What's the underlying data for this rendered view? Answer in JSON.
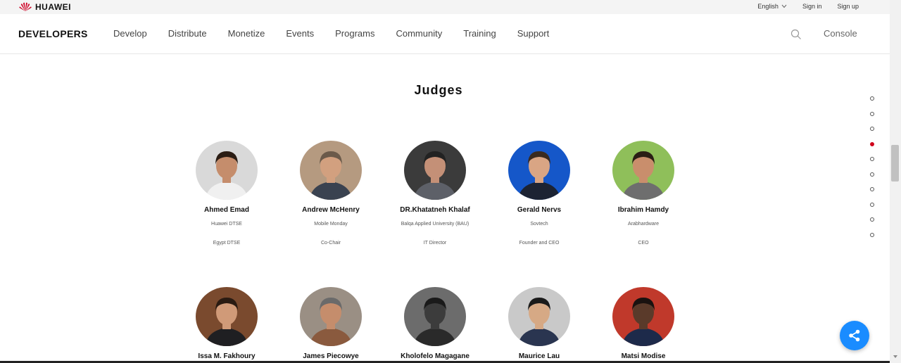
{
  "topbar": {
    "brand": "HUAWEI",
    "language": "English",
    "sign_in": "Sign in",
    "sign_up": "Sign up"
  },
  "navbar": {
    "logo": "DEVELOPERS",
    "items": [
      "Develop",
      "Distribute",
      "Monetize",
      "Events",
      "Programs",
      "Community",
      "Training",
      "Support"
    ],
    "console": "Console"
  },
  "section": {
    "title": "Judges"
  },
  "judges_row1": [
    {
      "name": "Ahmed Emad",
      "org": "Huawei DTSE",
      "role": "Egypt DTSE",
      "bg": "#d9d9d9",
      "skin": "#c58d6c",
      "hair": "#2b1d14",
      "suit": "#f0f0f0"
    },
    {
      "name": "Andrew McHenry",
      "org": "Mobile Monday",
      "role": "Co-Chair",
      "bg": "#b59a80",
      "skin": "#d2a07f",
      "hair": "#6b5a4a",
      "suit": "#3a4250"
    },
    {
      "name": "DR.Khatatneh Khalaf",
      "org": "Balqa Applied University (BAU)",
      "role": "IT Director",
      "bg": "#3b3b3b",
      "skin": "#c49077",
      "hair": "#222",
      "suit": "#5d6068"
    },
    {
      "name": "Gerald Nervs",
      "org": "Sovtech",
      "role": "Founder and CEO",
      "bg": "#1557c9",
      "skin": "#d9a584",
      "hair": "#3a2a1e",
      "suit": "#1c2333"
    },
    {
      "name": "Ibrahim Hamdy",
      "org": "Arabhardware",
      "role": "CEO",
      "bg": "#8fbf5a",
      "skin": "#c98e6c",
      "hair": "#2a1e15",
      "suit": "#6e6e6e"
    }
  ],
  "judges_row2": [
    {
      "name": "Issa M. Fakhoury",
      "bg": "#7a4a2e",
      "skin": "#d09a78",
      "hair": "#2a1b12",
      "suit": "#1f1f22"
    },
    {
      "name": "James Piecowye",
      "bg": "#9a8f84",
      "skin": "#c58d6c",
      "hair": "#6a6a6a",
      "suit": "#8a5a3e"
    },
    {
      "name": "Kholofelo Magagane",
      "bg": "#6c6c6c",
      "skin": "#3c3c3c",
      "hair": "#1a1a1a",
      "suit": "#2a2a2a"
    },
    {
      "name": "Maurice Lau",
      "bg": "#c9c9c9",
      "skin": "#d6a985",
      "hair": "#1a1a1a",
      "suit": "#2a3550"
    },
    {
      "name": "Matsi Modise",
      "bg": "#c0392b",
      "skin": "#5a3a2a",
      "hair": "#1a1210",
      "suit": "#1d2a4a"
    }
  ],
  "pagination": {
    "count": 10,
    "active_index": 3
  },
  "icons": {
    "brand": "huawei-logo-icon",
    "lang": "chevron-down-icon",
    "search": "search-icon",
    "share": "share-icon"
  },
  "colors": {
    "brand_red": "#cf0a2c",
    "accent": "#1a8cff",
    "active_dot": "#d0021b"
  }
}
